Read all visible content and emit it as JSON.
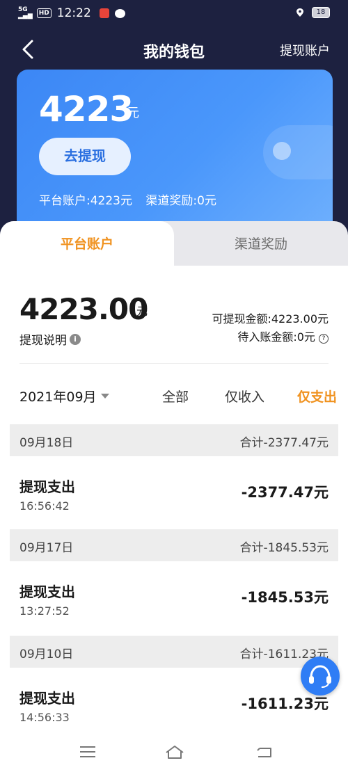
{
  "status_bar": {
    "signal": "5G",
    "hd": "HD",
    "time": "12:22",
    "battery": "18"
  },
  "nav": {
    "title": "我的钱包",
    "right_label": "提现账户"
  },
  "card": {
    "amount": "4223",
    "unit": "元",
    "withdraw_button": "去提现",
    "platform_account": "平台账户:4223元",
    "channel_reward": "渠道奖励:0元"
  },
  "tabs": [
    {
      "label": "平台账户",
      "active": true
    },
    {
      "label": "渠道奖励",
      "active": false
    }
  ],
  "summary": {
    "amount": "4223.00",
    "unit": "元",
    "explain_label": "提现说明",
    "withdrawable": "可提现金额:4223.00元",
    "pending": "待入账金额:0元"
  },
  "filter": {
    "month": "2021年09月",
    "all": "全部",
    "income_only": "仅收入",
    "expense_only": "仅支出",
    "selected": "仅支出"
  },
  "days": [
    {
      "date": "09月18日",
      "total": "合计-2377.47元",
      "records": [
        {
          "title": "提现支出",
          "time": "16:56:42",
          "amount": "-2377.47元"
        }
      ]
    },
    {
      "date": "09月17日",
      "total": "合计-1845.53元",
      "records": [
        {
          "title": "提现支出",
          "time": "13:27:52",
          "amount": "-1845.53元"
        }
      ]
    },
    {
      "date": "09月10日",
      "total": "合计-1611.23元",
      "records": [
        {
          "title": "提现支出",
          "time": "14:56:33",
          "amount": "-1611.23元"
        }
      ]
    }
  ],
  "colors": {
    "header_bg": "#1d2140",
    "card_blue": "#4a97fb",
    "accent_orange": "#f0921f"
  },
  "icons": {
    "back": "chevron-left-icon",
    "info": "info-icon",
    "help": "question-icon",
    "dropdown": "caret-down-icon",
    "service": "headset-icon",
    "menu": "menu-icon",
    "home": "home-icon",
    "back_nav": "return-icon"
  }
}
